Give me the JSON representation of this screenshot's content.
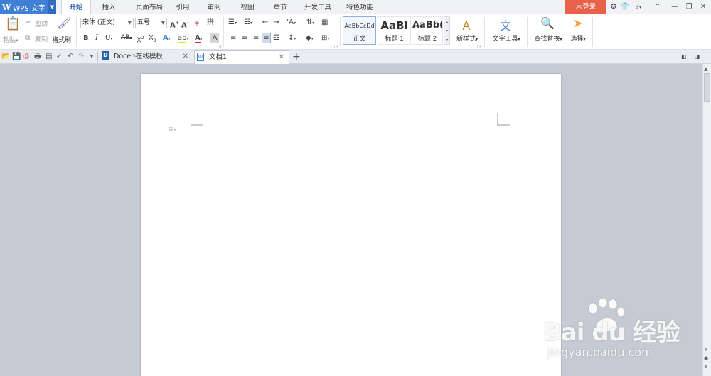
{
  "app": {
    "name": "WPS 文字"
  },
  "menu_tabs": [
    "开始",
    "插入",
    "页面布局",
    "引用",
    "审阅",
    "视图",
    "章节",
    "开发工具",
    "特色功能"
  ],
  "active_tab": "开始",
  "login_label": "未登录",
  "window_controls": {
    "help": "?",
    "help_arrow": "▾"
  },
  "ribbon": {
    "paste": "粘贴",
    "cut": "剪切",
    "copy": "复制",
    "format_painter": "格式刷",
    "font_name": "宋体 (正文)",
    "font_size": "五号",
    "styles": [
      {
        "sample": "AaBbCcDd",
        "label": "正文"
      },
      {
        "sample": "AaBl",
        "label": "标题 1"
      },
      {
        "sample": "AaBb(",
        "label": "标题 2"
      }
    ],
    "new_style": "新样式",
    "text_tools": "文字工具",
    "find_replace": "查找替换",
    "select": "选择"
  },
  "doc_tabs": [
    {
      "label": "Docer-在线模板",
      "active": false
    },
    {
      "label": "文档1",
      "active": true
    }
  ],
  "new_tab_label": "+",
  "watermark": {
    "line1": "Bai du 经验",
    "line2": "jingyan.baidu.com"
  },
  "colors": {
    "accent": "#3f7fd6",
    "login": "#e8614a",
    "background": "#c5cad3"
  }
}
